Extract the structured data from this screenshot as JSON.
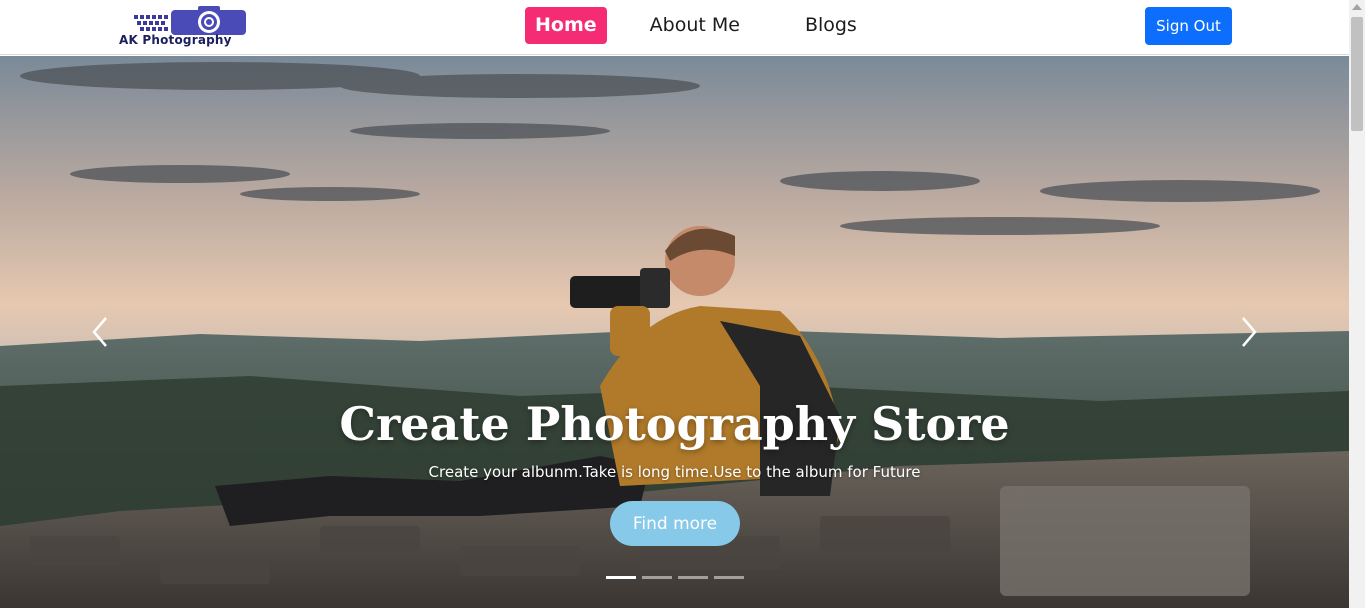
{
  "brand": {
    "name": "AK Photography",
    "icon": "camera-logo-icon",
    "color": "#1d1f5e"
  },
  "nav": {
    "items": [
      {
        "label": "Home",
        "active": true
      },
      {
        "label": "About Me",
        "active": false
      },
      {
        "label": "Blogs",
        "active": false
      }
    ],
    "active_color": "#f52c73",
    "signout_label": "Sign Out",
    "signout_color": "#0d6efd"
  },
  "hero": {
    "title": "Create Photography Store",
    "subtitle": "Create your albunm.Take is long time.Use to the album for Future",
    "cta_label": "Find more",
    "cta_color": "#87c9e8",
    "prev_icon": "chevron-left-icon",
    "next_icon": "chevron-right-icon",
    "slide_count": 4,
    "active_slide": 1
  }
}
